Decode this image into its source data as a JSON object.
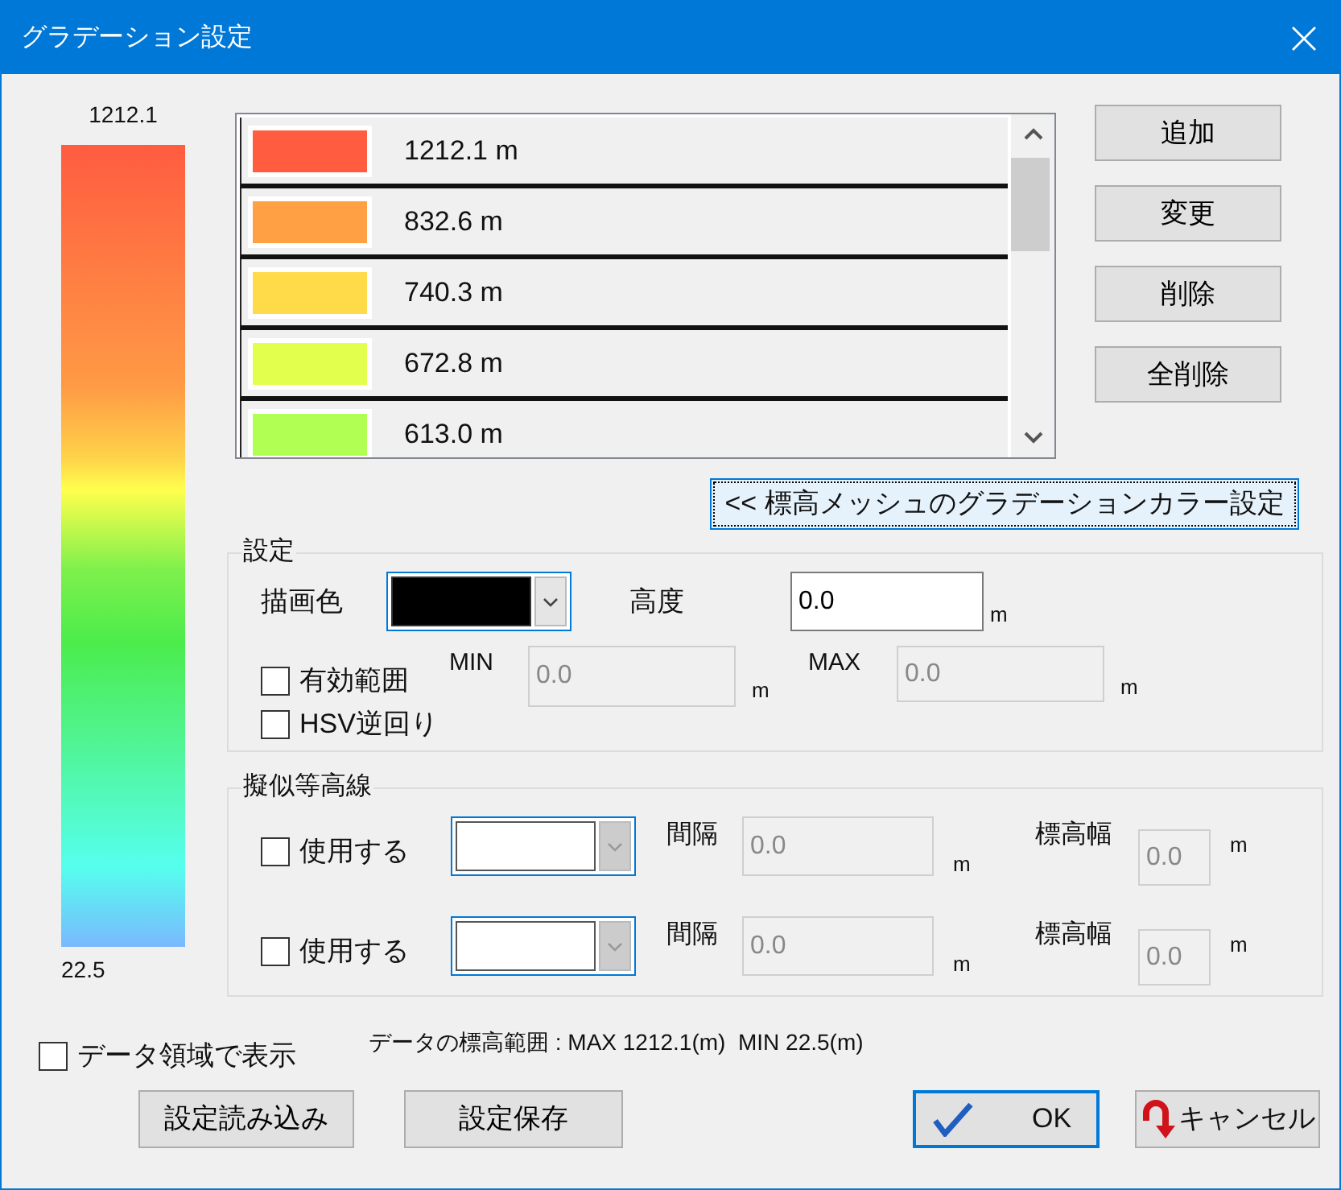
{
  "window": {
    "title": "グラデーション設定"
  },
  "scale": {
    "max_label": "1212.1",
    "min_label": "22.5"
  },
  "gradation_list": [
    {
      "label": "1212.1 m",
      "color": "#ff5c40"
    },
    {
      "label": "832.6 m",
      "color": "#ffa045"
    },
    {
      "label": "740.3 m",
      "color": "#ffdb4a"
    },
    {
      "label": "672.8 m",
      "color": "#e3ff4d"
    },
    {
      "label": "613.0 m",
      "color": "#b0ff52"
    }
  ],
  "side_buttons": [
    "追加",
    "変更",
    "削除",
    "全削除"
  ],
  "mesh_button": "<< 標高メッシュのグラデーションカラー設定",
  "settings": {
    "title": "設定",
    "draw_color": {
      "label": "描画色",
      "color": "#000000"
    },
    "altitude": {
      "label": "高度",
      "value": "0.0",
      "unit": "m",
      "disabled": false
    },
    "range": {
      "label": "有効範囲",
      "checked": false,
      "min_label": "MIN",
      "min": {
        "value": "0.0",
        "disabled": true
      },
      "min_unit": "m",
      "max_label": "MAX",
      "max": {
        "value": "0.0",
        "disabled": true
      },
      "max_unit": "m"
    },
    "hsv": {
      "label": "HSV逆回り",
      "checked": false
    }
  },
  "contours": {
    "title": "擬似等高線",
    "rows": [
      {
        "label": "使用する",
        "checked": false,
        "interval_label": "間隔",
        "interval": {
          "value": "0.0",
          "disabled": true
        },
        "interval_unit": "m",
        "width_label": "標高幅",
        "width": {
          "value": "0.0",
          "disabled": true
        },
        "width_unit": "m"
      },
      {
        "label": "使用する",
        "checked": false,
        "interval_label": "間隔",
        "interval": {
          "value": "0.0",
          "disabled": true
        },
        "interval_unit": "m",
        "width_label": "標高幅",
        "width": {
          "value": "0.0",
          "disabled": true
        },
        "width_unit": "m"
      }
    ]
  },
  "display_in_data_area": {
    "label": "データ領域で表示",
    "checked": false
  },
  "range_text": "データの標高範囲 : MAX 1212.1(m)  MIN 22.5(m)",
  "buttons": {
    "load": "設定読み込み",
    "save": "設定保存",
    "ok": "OK",
    "cancel": "キャンセル"
  }
}
